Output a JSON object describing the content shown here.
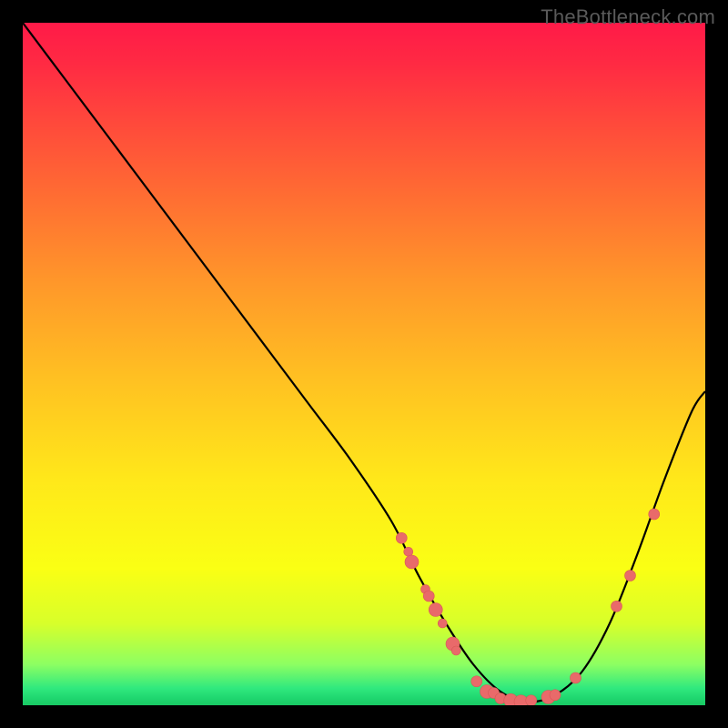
{
  "watermark": "TheBottleneck.com",
  "chart_data": {
    "type": "line",
    "title": "",
    "xlabel": "",
    "ylabel": "",
    "xlim": [
      0,
      100
    ],
    "ylim": [
      0,
      100
    ],
    "grid": false,
    "legend": false,
    "series": [
      {
        "name": "curve",
        "x": [
          0,
          6,
          12,
          18,
          24,
          30,
          36,
          42,
          48,
          54,
          58,
          62,
          66,
          70,
          74,
          78,
          82,
          86,
          90,
          94,
          98,
          100
        ],
        "y": [
          100,
          92,
          84,
          76,
          68,
          60,
          52,
          44,
          36,
          27,
          19,
          12,
          6,
          2,
          0.5,
          1.5,
          5,
          12,
          22,
          33,
          43,
          46
        ]
      }
    ],
    "markers": [
      {
        "x": 55.5,
        "y": 24.5,
        "size": "md"
      },
      {
        "x": 56.5,
        "y": 22.5,
        "size": "sm"
      },
      {
        "x": 57.0,
        "y": 21.0,
        "size": "lg"
      },
      {
        "x": 59.0,
        "y": 17.0,
        "size": "sm"
      },
      {
        "x": 59.5,
        "y": 16.0,
        "size": "md"
      },
      {
        "x": 60.5,
        "y": 14.0,
        "size": "lg"
      },
      {
        "x": 61.5,
        "y": 12.0,
        "size": "sm"
      },
      {
        "x": 63.0,
        "y": 9.0,
        "size": "lg"
      },
      {
        "x": 63.5,
        "y": 8.0,
        "size": "sm"
      },
      {
        "x": 66.5,
        "y": 3.5,
        "size": "md"
      },
      {
        "x": 68.0,
        "y": 2.0,
        "size": "lg"
      },
      {
        "x": 69.0,
        "y": 1.8,
        "size": "md"
      },
      {
        "x": 70.0,
        "y": 1.0,
        "size": "md"
      },
      {
        "x": 71.5,
        "y": 0.7,
        "size": "lg"
      },
      {
        "x": 73.0,
        "y": 0.5,
        "size": "lg"
      },
      {
        "x": 74.5,
        "y": 0.7,
        "size": "md"
      },
      {
        "x": 77.0,
        "y": 1.2,
        "size": "lg"
      },
      {
        "x": 78.0,
        "y": 1.5,
        "size": "md"
      },
      {
        "x": 81.0,
        "y": 4.0,
        "size": "md"
      },
      {
        "x": 87.0,
        "y": 14.5,
        "size": "md"
      },
      {
        "x": 89.0,
        "y": 19.0,
        "size": "md"
      },
      {
        "x": 92.5,
        "y": 28.0,
        "size": "md"
      }
    ],
    "gradient_colors": {
      "top": "#ff1a48",
      "mid": "#ffe81a",
      "bottom": "#19c963"
    },
    "marker_color": "#e96a6a"
  }
}
